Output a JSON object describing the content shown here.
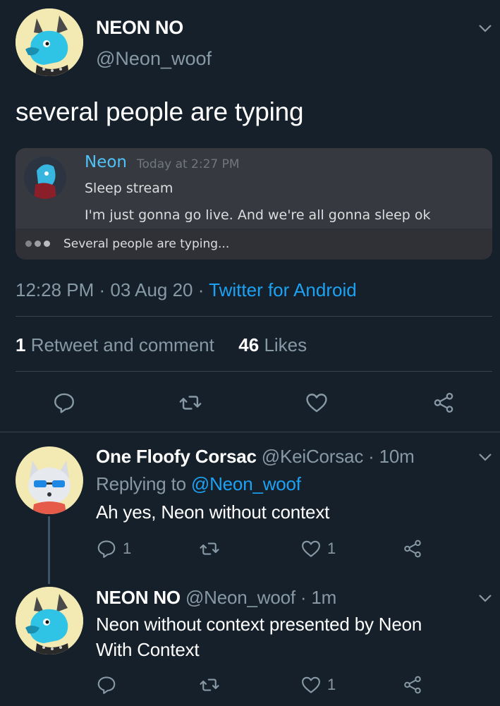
{
  "main_tweet": {
    "display_name": "NEON NO",
    "handle": "@Neon_woof",
    "text": "several people are typing",
    "timestamp": "12:28 PM · 03 Aug 20 · ",
    "source": "Twitter for Android",
    "retweets_count": "1",
    "retweets_label": " Retweet and comment",
    "likes_count": "46",
    "likes_label": " Likes"
  },
  "embedded_image": {
    "username": "Neon",
    "time": "Today at 2:27 PM",
    "line1": "Sleep stream",
    "line2": "I'm just gonna go live. And we're all gonna sleep ok",
    "typing": "Several people are typing..."
  },
  "replies": [
    {
      "display_name": "One Floofy Corsac",
      "handle": " @KeiCorsac · 10m",
      "replying_prefix": "Replying to ",
      "replying_to": "@Neon_woof",
      "text": "Ah yes, Neon without context",
      "reply_count": "1",
      "like_count": "1"
    },
    {
      "display_name": "NEON NO",
      "handle": " @Neon_woof · 1m",
      "text_line1": "Neon without context presented by Neon",
      "text_line2": "With Context",
      "like_count": "1"
    }
  ],
  "colors": {
    "background": "#15202b",
    "accent": "#1da1f2",
    "secondary_text": "#8899a6",
    "discord_bg": "#36393f",
    "discord_name": "#4fc3f7"
  }
}
